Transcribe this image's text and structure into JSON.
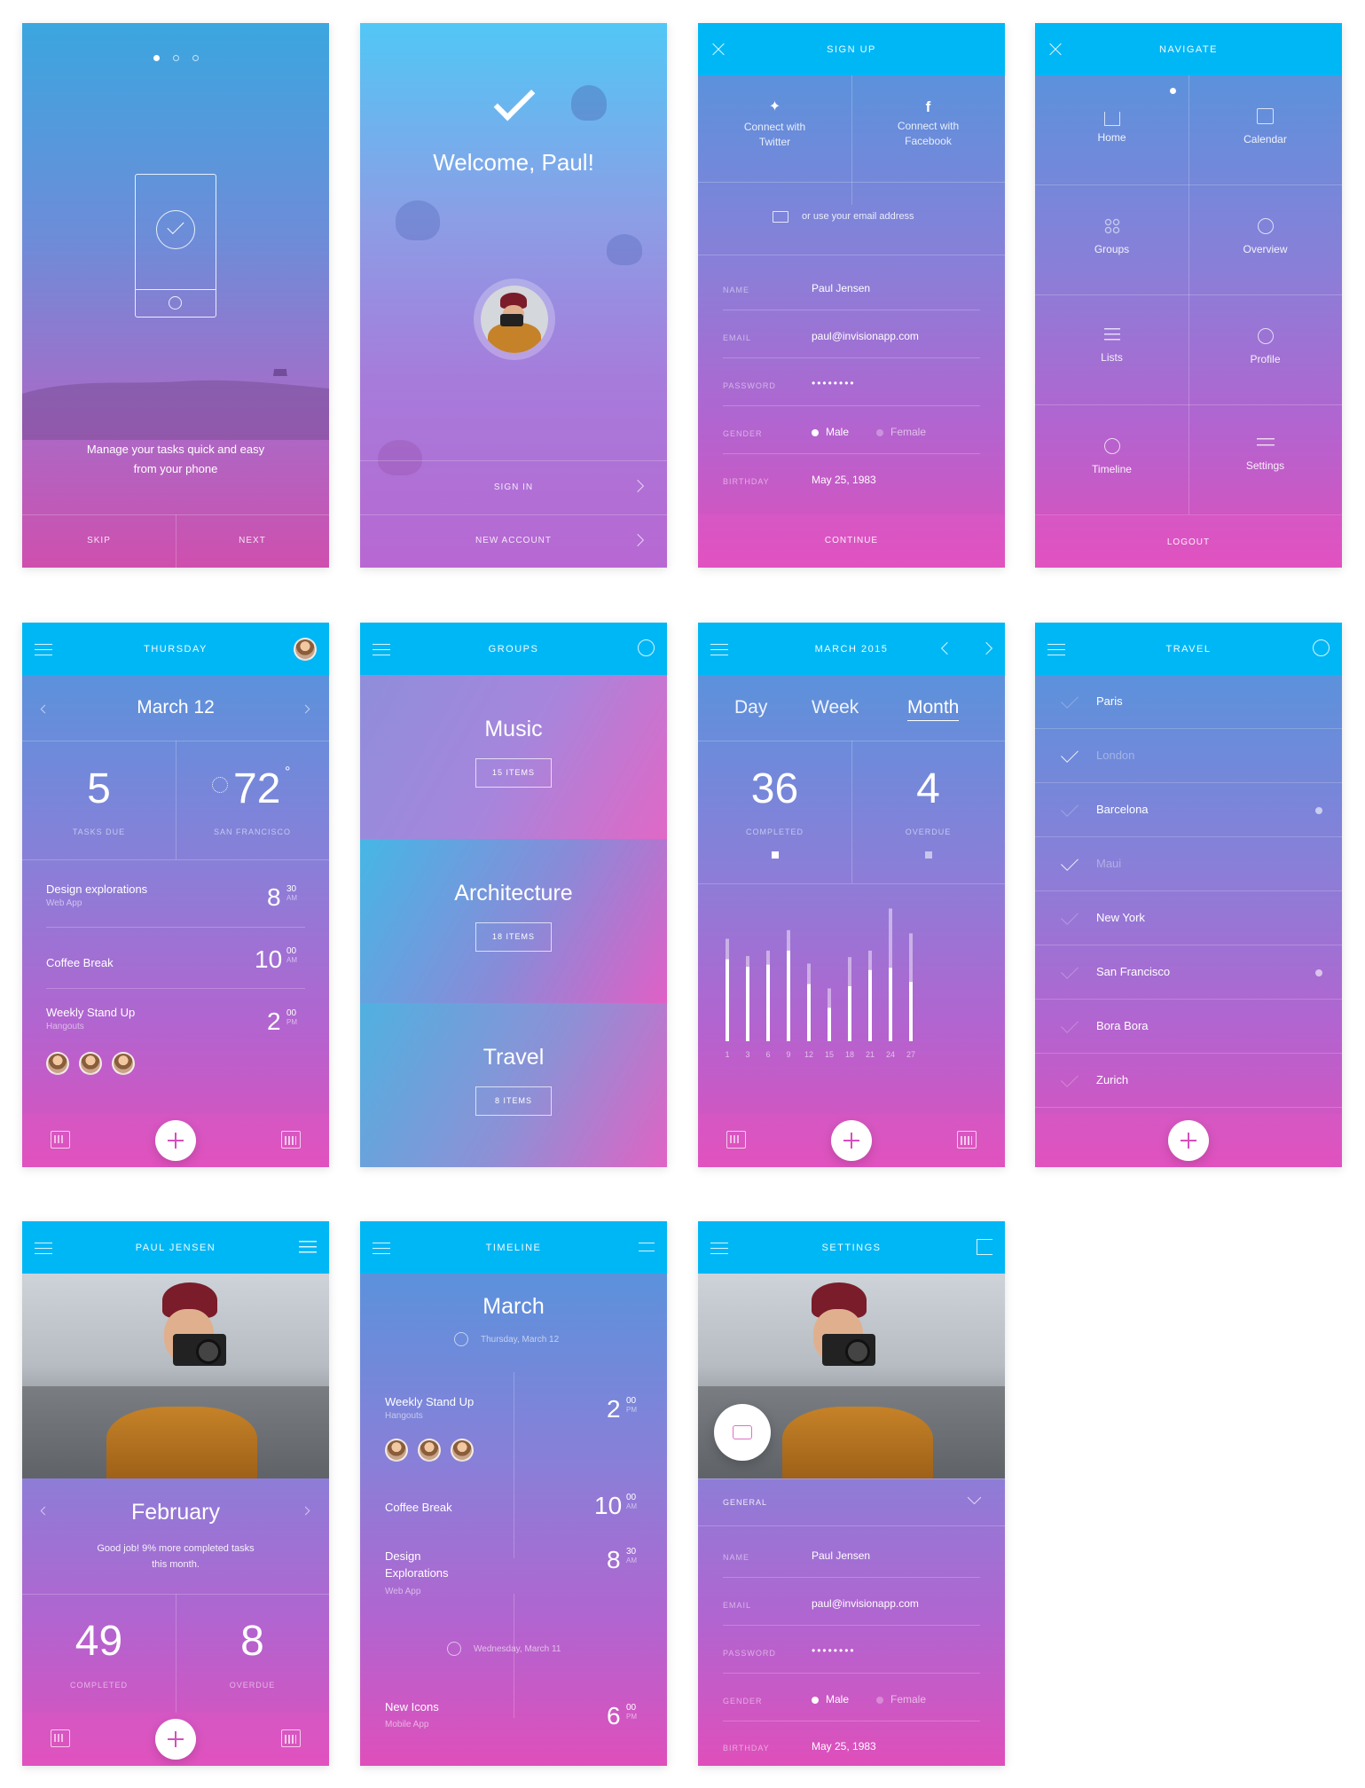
{
  "onboarding": {
    "tagline_line1": "Manage your tasks quick and easy",
    "tagline_line2": "from your phone",
    "skip": "SKIP",
    "next": "NEXT"
  },
  "welcome": {
    "title": "Welcome, Paul!",
    "sign_in": "SIGN IN",
    "new_account": "NEW ACCOUNT"
  },
  "signup": {
    "title": "SIGN UP",
    "twitter_l1": "Connect with",
    "twitter_l2": "Twitter",
    "facebook_l1": "Connect with",
    "facebook_l2": "Facebook",
    "email_prompt": "or use your email address",
    "fields": [
      {
        "label": "NAME",
        "value": "Paul Jensen"
      },
      {
        "label": "EMAIL",
        "value": "paul@invisionapp.com"
      },
      {
        "label": "PASSWORD",
        "value": "••••••••"
      },
      {
        "label": "GENDER",
        "male": "Male",
        "female": "Female"
      },
      {
        "label": "BIRTHDAY",
        "value": "May 25, 1983"
      }
    ],
    "continue": "CONTINUE"
  },
  "navigate": {
    "title": "NAVIGATE",
    "items": [
      "Home",
      "Calendar",
      "Groups",
      "Overview",
      "Lists",
      "Profile",
      "Timeline",
      "Settings"
    ],
    "logout": "LOGOUT"
  },
  "today": {
    "title": "THURSDAY",
    "date": "March 12",
    "tasks_count": "5",
    "tasks_label": "TASKS DUE",
    "temp": "72",
    "temp_deg": "°",
    "city": "SAN FRANCISCO",
    "events": [
      {
        "title": "Design explorations",
        "sub": "Web App",
        "hour": "8",
        "min": "30",
        "ampm": "AM"
      },
      {
        "title": "Coffee Break",
        "sub": "",
        "hour": "10",
        "min": "00",
        "ampm": "AM"
      },
      {
        "title": "Weekly Stand Up",
        "sub": "Hangouts",
        "hour": "2",
        "min": "00",
        "ampm": "PM"
      }
    ]
  },
  "groups": {
    "title": "GROUPS",
    "items": [
      {
        "name": "Music",
        "count": "15 ITEMS"
      },
      {
        "name": "Architecture",
        "count": "18 ITEMS"
      },
      {
        "name": "Travel",
        "count": "8 ITEMS"
      }
    ]
  },
  "overview": {
    "title": "MARCH 2015",
    "tabs": [
      "Day",
      "Week",
      "Month"
    ],
    "completed": "36",
    "completed_label": "COMPLETED",
    "overdue": "4",
    "overdue_label": "OVERDUE"
  },
  "chart_data": {
    "type": "bar",
    "categories": [
      "1",
      "3",
      "6",
      "9",
      "12",
      "15",
      "18",
      "21",
      "24",
      "27"
    ],
    "series": [
      {
        "values": [
          7.6,
          6.9,
          7.1,
          8.4,
          5.3,
          3.1,
          5.1,
          6.6,
          6.8,
          5.5
        ]
      },
      {
        "values": [
          9.5,
          7.9,
          8.4,
          10.3,
          7.2,
          4.9,
          7.8,
          8.4,
          12.3,
          10.0
        ]
      }
    ],
    "ylim": [
      0,
      12.5
    ]
  },
  "travel": {
    "title": "TRAVEL",
    "cities": [
      {
        "name": "Paris",
        "done": false,
        "dot": false
      },
      {
        "name": "London",
        "done": true,
        "dot": false
      },
      {
        "name": "Barcelona",
        "done": false,
        "dot": true
      },
      {
        "name": "Maui",
        "done": true,
        "dot": false
      },
      {
        "name": "New York",
        "done": false,
        "dot": false
      },
      {
        "name": "San Francisco",
        "done": false,
        "dot": true
      },
      {
        "name": "Bora Bora",
        "done": false,
        "dot": false
      },
      {
        "name": "Zurich",
        "done": false,
        "dot": false
      }
    ]
  },
  "profile": {
    "title": "PAUL JENSEN",
    "month": "February",
    "msg_l1": "Good job! 9% more completed tasks",
    "msg_l2": "this month.",
    "completed": "49",
    "completed_label": "COMPLETED",
    "overdue": "8",
    "overdue_label": "OVERDUE"
  },
  "timeline": {
    "title": "TIMELINE",
    "month": "March",
    "day1": "Thursday, March 12",
    "day2": "Wednesday, March 11",
    "events": [
      {
        "title": "Weekly Stand Up",
        "sub": "Hangouts",
        "hour": "2",
        "min": "00",
        "ampm": "PM"
      },
      {
        "title": "Coffee Break",
        "sub": "",
        "hour": "10",
        "min": "00",
        "ampm": "AM"
      },
      {
        "title": "Design Explorations",
        "sub": "Web App",
        "hour": "8",
        "min": "30",
        "ampm": "AM"
      },
      {
        "title": "New Icons",
        "sub": "Mobile App",
        "hour": "6",
        "min": "00",
        "ampm": "PM"
      }
    ]
  },
  "settings": {
    "title": "SETTINGS",
    "section": "GENERAL",
    "fields": [
      {
        "label": "NAME",
        "value": "Paul Jensen"
      },
      {
        "label": "EMAIL",
        "value": "paul@invisionapp.com"
      },
      {
        "label": "PASSWORD",
        "value": "••••••••"
      },
      {
        "label": "GENDER",
        "male": "Male",
        "female": "Female"
      },
      {
        "label": "BIRTHDAY",
        "value": "May 25, 1983"
      }
    ]
  },
  "colors": {
    "topbar": "#00b7f6",
    "accent_pink": "#df4fbb",
    "accent_blue": "#4f97dc"
  }
}
